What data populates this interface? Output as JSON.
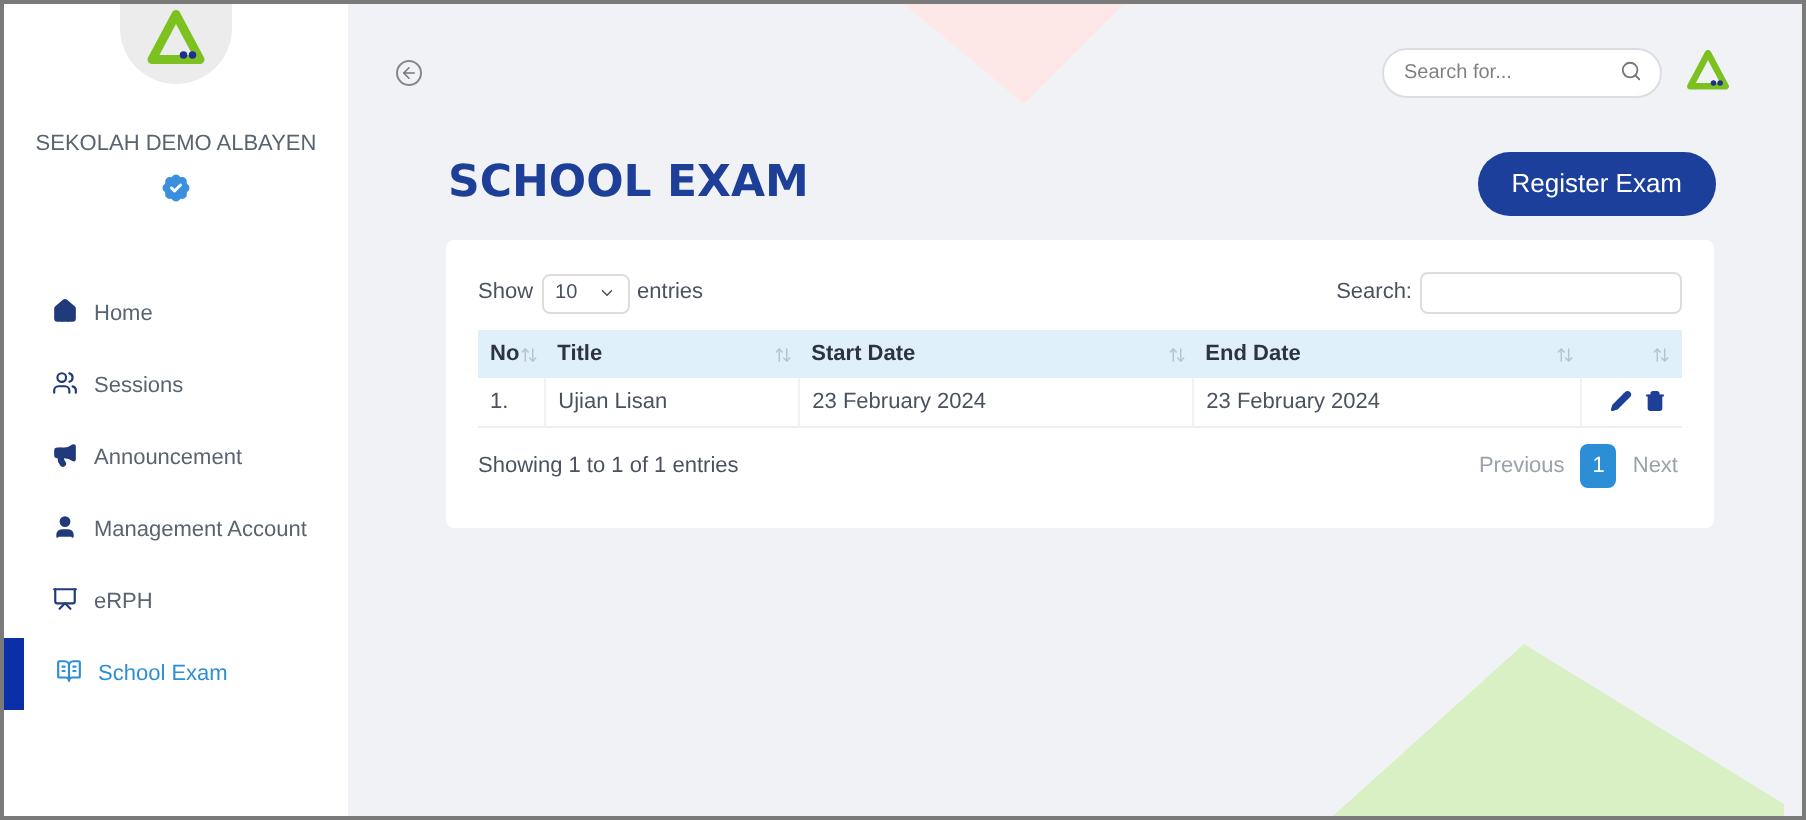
{
  "sidebar": {
    "school_name": "SEKOLAH DEMO ALBAYEN",
    "verified": true,
    "items": [
      {
        "label": "Home",
        "kind": "home",
        "selected": false
      },
      {
        "label": "Sessions",
        "kind": "users",
        "selected": false
      },
      {
        "label": "Announcement",
        "kind": "megaphone",
        "selected": false
      },
      {
        "label": "Management Account",
        "kind": "user",
        "selected": false
      },
      {
        "label": "eRPH",
        "kind": "board",
        "selected": false
      },
      {
        "label": "School Exam",
        "kind": "book",
        "selected": true
      }
    ]
  },
  "topbar": {
    "search": {
      "placeholder": "Search for..."
    }
  },
  "page": {
    "title": "SCHOOL EXAM",
    "button": "Register Exam"
  },
  "table": {
    "show_label": "Show",
    "page_size": "10",
    "entries_label": "entries",
    "search_label": "Search:",
    "columns": [
      "No",
      "Title",
      "Start Date",
      "End Date"
    ],
    "rows": [
      {
        "cells": [
          "1.",
          "Ujian Lisan",
          "23 February 2024",
          "23 February 2024"
        ]
      }
    ],
    "info": "Showing 1 to 1 of 1 entries",
    "pagination": {
      "previous": "Previous",
      "pages": [
        {
          "label": "1",
          "selected": true
        }
      ],
      "next": "Next"
    }
  }
}
